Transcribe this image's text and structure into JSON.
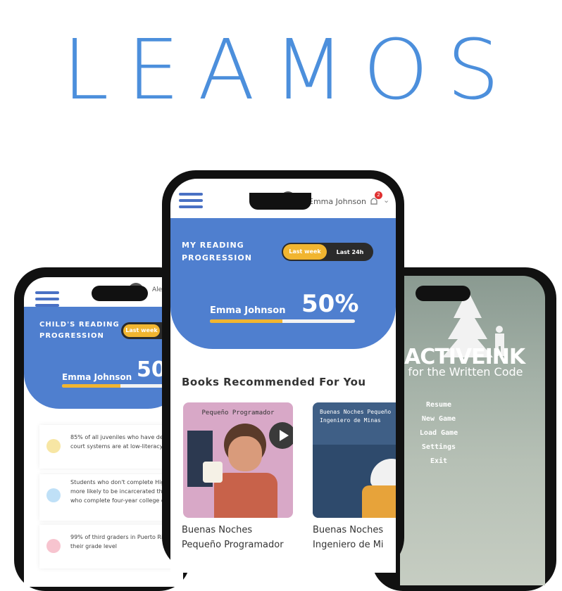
{
  "brand": {
    "title": "LEAMOS",
    "color": "#4c8fdc"
  },
  "left_phone": {
    "user_name_truncated": "Ale",
    "panel_title_line1": "CHILD'S READING",
    "panel_title_line2": "PROGRESSION",
    "toggle_on": "Last week",
    "child_name": "Emma Johnson",
    "percent": "50",
    "progress": 0.5,
    "stats": [
      {
        "line1": "85% of all juveniles who have dealt w",
        "line2": "court systems are at low-literacy level",
        "color": "#f7e6a4"
      },
      {
        "line1": "Students who don't complete High S",
        "line2": "more likely to be incarcerated than",
        "line3": "who complete four-year college deg",
        "color": "#bfe0f7"
      },
      {
        "line1": "99% of third graders in Puerto Rico re",
        "line2": "their grade level",
        "color": "#f7c4cf"
      }
    ]
  },
  "center_phone": {
    "user_name": "Emma Johnson",
    "notification_count": "2",
    "panel_title_line1": "MY READING",
    "panel_title_line2": "PROGRESSION",
    "toggle_on": "Last week",
    "toggle_off": "Last 24h",
    "reader_name": "Emma Johnson",
    "percent": "50%",
    "progress": 0.5,
    "section_title": "Books Recommended For You",
    "books": [
      {
        "cover_title": "Pequeño Programador",
        "caption_line1": "Buenas Noches",
        "caption_line2": "Pequeño Programador"
      },
      {
        "cover_title_line1": "Buenas Noches Pequeño",
        "cover_title_line2": "Ingeniero de Minas",
        "caption_line1": "Buenas Noches",
        "caption_line2": "Ingeniero de Mi"
      }
    ]
  },
  "right_phone": {
    "logo_text": "ACTIVEINK",
    "subtitle": "t for the Written Code",
    "menu": [
      "Resume",
      "New Game",
      "Load Game",
      "Settings",
      "Exit"
    ]
  }
}
